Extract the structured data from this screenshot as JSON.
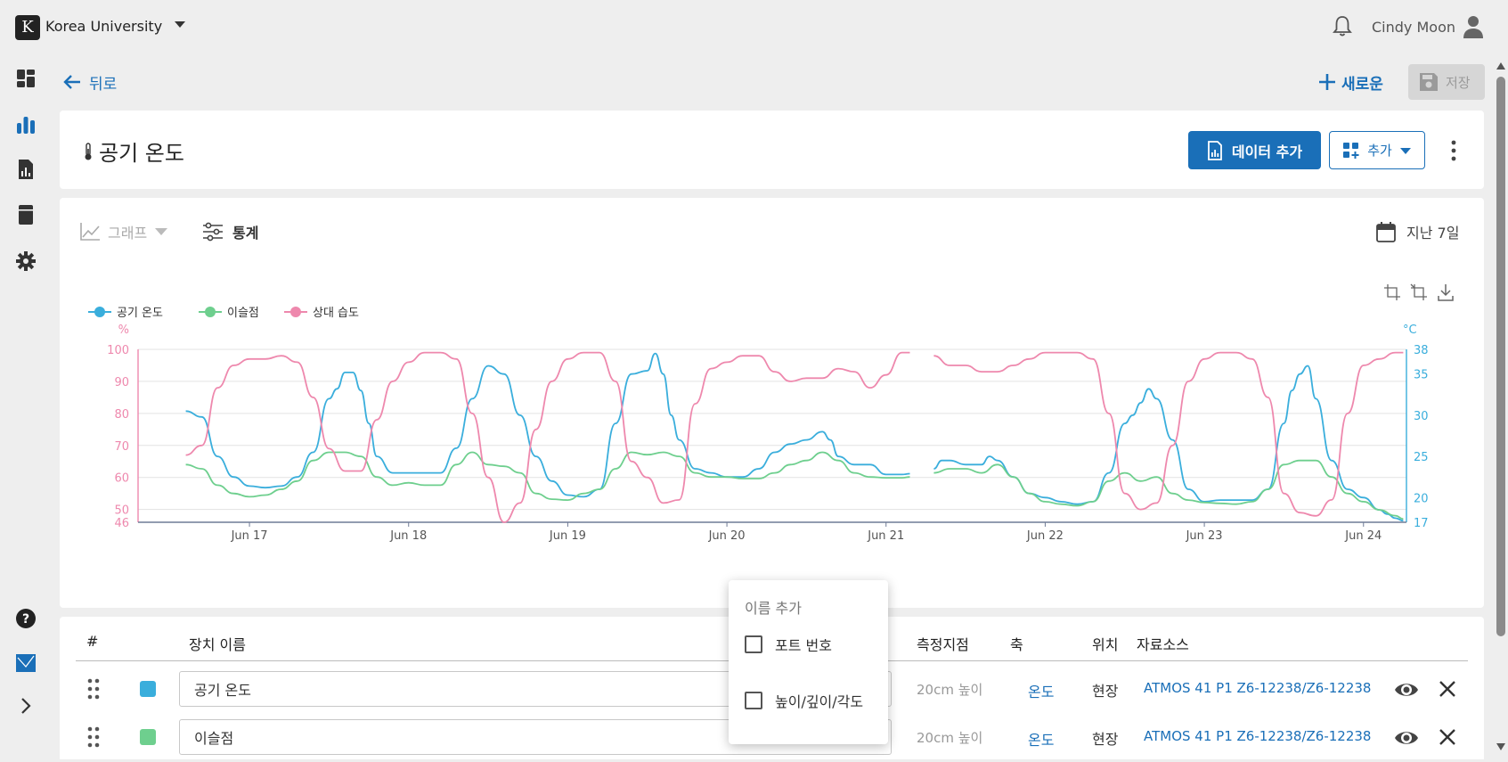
{
  "header": {
    "org_logo_letter": "K",
    "org_name": "Korea University",
    "user_name": "Cindy Moon"
  },
  "sidebar": {
    "icons": [
      "dashboard-icon",
      "bar-chart-icon",
      "report-icon",
      "device-icon",
      "settings-icon",
      "help-icon",
      "map-icon",
      "expand-icon"
    ]
  },
  "toolbar": {
    "back_label": "뒤로",
    "new_label": "새로운",
    "save_label": "저장"
  },
  "widget": {
    "title": "공기 온도",
    "add_data_label": "데이터 추가",
    "add_label": "추가"
  },
  "chart_controls": {
    "graph_label": "그래프",
    "stats_label": "통계",
    "date_range_label": "지난 7일"
  },
  "chart_data": {
    "type": "line",
    "legend": [
      "공기 온도",
      "이슬점",
      "상대 습도"
    ],
    "y_left_unit": "%",
    "y_right_unit": "°C",
    "y_left_ticks": [
      46,
      50,
      60,
      70,
      80,
      90,
      100
    ],
    "y_right_ticks": [
      17,
      20,
      25,
      30,
      35,
      38
    ],
    "x_ticks": [
      "Jun 17",
      "Jun 18",
      "Jun 19",
      "Jun 20",
      "Jun 21",
      "Jun 22",
      "Jun 23",
      "Jun 24"
    ],
    "ylim_left": [
      46,
      100
    ],
    "ylim_right": [
      17,
      38
    ],
    "colors": {
      "air_temp": "#3aaedc",
      "dew_point": "#6ecf8e",
      "humidity": "#ee88ad"
    },
    "series": [
      {
        "name": "공기 온도",
        "axis": "right",
        "color": "#3aaedc",
        "x": [
          16.6,
          16.7,
          16.8,
          16.9,
          17.0,
          17.1,
          17.2,
          17.3,
          17.4,
          17.5,
          17.55,
          17.6,
          17.65,
          17.7,
          17.75,
          17.8,
          17.9,
          18.0,
          18.1,
          18.2,
          18.3,
          18.4,
          18.5,
          18.6,
          18.7,
          18.8,
          18.9,
          19.0,
          19.1,
          19.2,
          19.3,
          19.4,
          19.5,
          19.55,
          19.6,
          19.65,
          19.7,
          19.8,
          19.9,
          20.0,
          20.1,
          20.2,
          20.3,
          20.4,
          20.5,
          20.6,
          20.65,
          20.7,
          20.8,
          20.9,
          21.0,
          21.1,
          21.15
        ],
        "y": [
          30.5,
          29.8,
          25,
          22.5,
          21.4,
          21.2,
          21.4,
          22.5,
          25.5,
          32,
          33.2,
          35.2,
          35.2,
          33,
          29,
          25,
          23,
          23,
          23,
          23,
          26,
          32,
          36,
          35,
          30,
          25,
          22,
          20.3,
          20.1,
          21,
          29,
          35,
          35.4,
          37.5,
          35,
          30,
          27,
          23.5,
          23,
          22.5,
          22.5,
          23.5,
          25.5,
          26.5,
          27,
          28,
          27,
          25,
          24,
          24,
          22.8,
          22.8,
          22.9
        ]
      },
      {
        "name": "공기 온도",
        "axis": "right",
        "color": "#3aaedc",
        "x": [
          21.3,
          21.35,
          21.4,
          21.5,
          21.6,
          21.65,
          21.7,
          21.8,
          21.9,
          22.0,
          22.1,
          22.2,
          22.3,
          22.4,
          22.5,
          22.55,
          22.6,
          22.65,
          22.7,
          22.8,
          22.9,
          23.0,
          23.1,
          23.2,
          23.3,
          23.4,
          23.5,
          23.55,
          23.6,
          23.65,
          23.7,
          23.8,
          23.9,
          24.0,
          24.1,
          24.15,
          24.2,
          24.25
        ],
        "y": [
          23.5,
          24.5,
          24.5,
          24,
          24,
          25,
          24.5,
          22.5,
          20.5,
          20,
          19.5,
          19.2,
          19.5,
          23,
          29,
          30,
          31.5,
          33.2,
          32,
          27,
          21,
          19.5,
          19.7,
          19.7,
          19.7,
          21,
          29,
          33,
          35,
          36,
          32,
          24.5,
          21,
          20,
          18.5,
          18,
          17.5,
          17.2
        ]
      },
      {
        "name": "이슬점",
        "axis": "right",
        "color": "#6ecf8e",
        "x": [
          16.6,
          16.7,
          16.8,
          16.9,
          17.0,
          17.1,
          17.2,
          17.3,
          17.4,
          17.5,
          17.6,
          17.7,
          17.8,
          17.9,
          18.0,
          18.1,
          18.2,
          18.3,
          18.4,
          18.5,
          18.6,
          18.7,
          18.8,
          18.9,
          19.0,
          19.1,
          19.2,
          19.3,
          19.4,
          19.5,
          19.6,
          19.7,
          19.8,
          19.9,
          20.0,
          20.1,
          20.2,
          20.3,
          20.4,
          20.5,
          20.6,
          20.7,
          20.8,
          20.9,
          21.0,
          21.1,
          21.15
        ],
        "y": [
          24,
          23.5,
          21.5,
          20.5,
          20.1,
          20.3,
          21,
          22,
          24.5,
          25.5,
          25.5,
          25,
          22.5,
          21.5,
          21.8,
          21.5,
          21.5,
          24,
          25.5,
          24,
          23.8,
          23,
          20.5,
          19.8,
          19.7,
          20.5,
          21,
          23.5,
          25.5,
          25.2,
          25.5,
          25,
          23,
          22.5,
          22.5,
          22.3,
          22.3,
          23,
          24,
          24.5,
          25.5,
          24.5,
          23,
          22.5,
          22.4,
          22.4,
          22.5
        ]
      },
      {
        "name": "이슬점",
        "axis": "right",
        "color": "#6ecf8e",
        "x": [
          21.3,
          21.4,
          21.5,
          21.6,
          21.7,
          21.8,
          21.9,
          22.0,
          22.1,
          22.2,
          22.3,
          22.4,
          22.5,
          22.6,
          22.7,
          22.8,
          22.9,
          23.0,
          23.1,
          23.2,
          23.3,
          23.4,
          23.5,
          23.6,
          23.7,
          23.8,
          23.9,
          24.0,
          24.1,
          24.2,
          24.25
        ],
        "y": [
          23,
          23.5,
          23.5,
          23,
          24,
          22.5,
          20.5,
          19.5,
          19.2,
          19,
          19.5,
          22,
          23,
          22,
          22.5,
          20.5,
          19.7,
          19.4,
          19.3,
          19.2,
          19.5,
          21,
          24,
          24.5,
          24.5,
          22.5,
          20.5,
          19.5,
          18.5,
          17.8,
          17.4
        ]
      },
      {
        "name": "상대 습도",
        "axis": "left",
        "color": "#ee88ad",
        "x": [
          16.6,
          16.7,
          16.8,
          16.9,
          17.0,
          17.1,
          17.2,
          17.3,
          17.4,
          17.5,
          17.6,
          17.7,
          17.8,
          17.9,
          18.0,
          18.1,
          18.2,
          18.3,
          18.4,
          18.5,
          18.6,
          18.7,
          18.8,
          18.9,
          19.0,
          19.1,
          19.2,
          19.3,
          19.4,
          19.5,
          19.6,
          19.7,
          19.8,
          19.9,
          20.0,
          20.1,
          20.2,
          20.3,
          20.4,
          20.5,
          20.6,
          20.7,
          20.8,
          20.9,
          21.0,
          21.1,
          21.15
        ],
        "y": [
          67,
          70,
          88,
          95,
          97,
          97,
          98,
          96,
          85,
          69,
          62,
          62,
          78,
          90,
          96,
          99,
          99,
          97,
          80,
          60,
          46,
          52,
          75,
          90,
          97,
          99,
          99,
          90,
          65,
          60,
          52,
          53,
          83,
          94,
          96,
          98,
          98,
          93,
          90,
          91,
          91,
          94,
          93,
          88,
          92,
          99,
          99
        ]
      },
      {
        "name": "상대 습도",
        "axis": "left",
        "color": "#ee88ad",
        "x": [
          21.3,
          21.4,
          21.5,
          21.6,
          21.7,
          21.8,
          21.9,
          22.0,
          22.1,
          22.2,
          22.3,
          22.4,
          22.5,
          22.6,
          22.7,
          22.8,
          22.9,
          23.0,
          23.1,
          23.2,
          23.3,
          23.4,
          23.5,
          23.6,
          23.7,
          23.8,
          23.9,
          24.0,
          24.1,
          24.2,
          24.25
        ],
        "y": [
          98,
          95,
          95,
          93,
          93,
          95,
          97,
          99,
          99,
          99,
          97,
          80,
          55,
          50,
          52,
          70,
          90,
          97,
          99,
          99,
          97,
          85,
          55,
          49,
          48,
          53,
          80,
          95,
          97,
          99,
          99
        ]
      }
    ]
  },
  "table": {
    "headers": {
      "num": "#",
      "device_name": "장치 이름",
      "measure_point": "측정지점",
      "axis": "축",
      "location": "위치",
      "source": "자료소스"
    },
    "rows": [
      {
        "color": "#3aaedc",
        "name": "공기 온도",
        "height": "20cm 높이",
        "axis": "온도",
        "location": "현장",
        "source": "ATMOS 41 P1 Z6-12238/Z6-12238"
      },
      {
        "color": "#6ecf8e",
        "name": "이슬점",
        "height": "20cm 높이",
        "axis": "온도",
        "location": "현장",
        "source": "ATMOS 41 P1 Z6-12238/Z6-12238"
      }
    ]
  },
  "popup": {
    "title": "이름 추가",
    "options": [
      "포트 번호",
      "높이/깊이/각도"
    ]
  }
}
